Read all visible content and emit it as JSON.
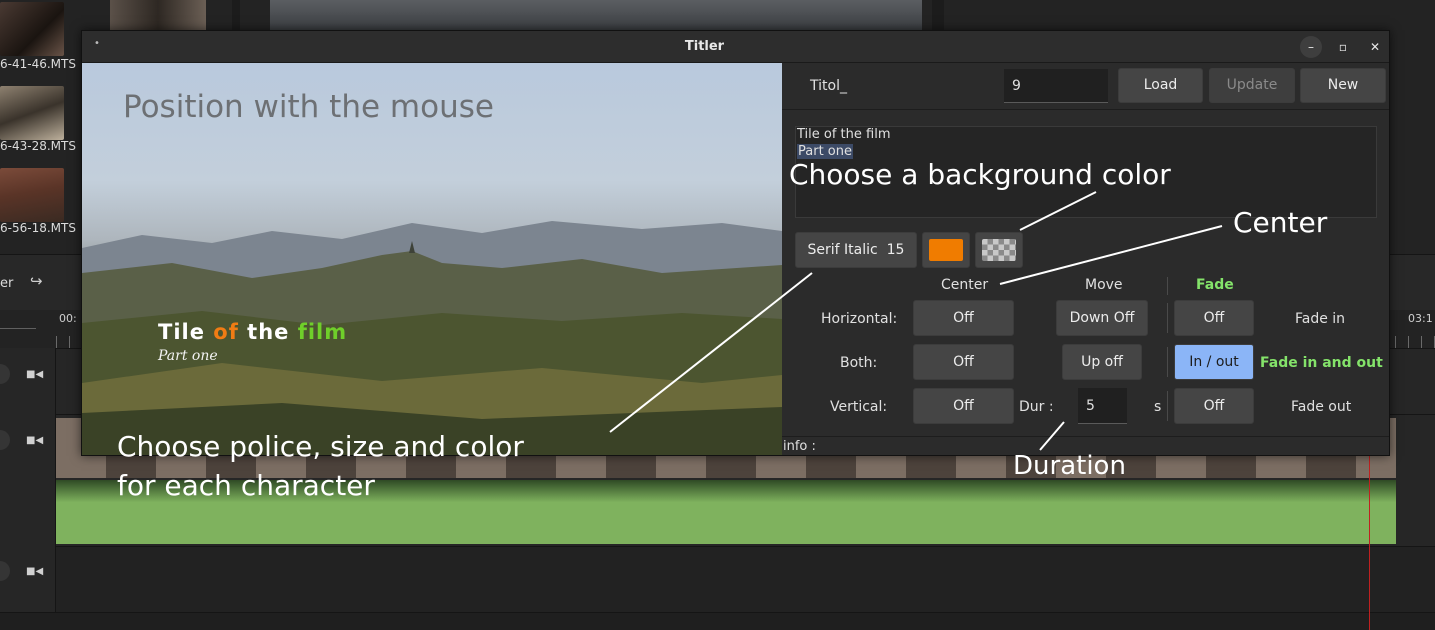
{
  "clips": [
    {
      "label": "6-41-46.MTS"
    },
    {
      "label": "6-43-28.MTS"
    },
    {
      "label": "6-56-18.MTS"
    }
  ],
  "timeline": {
    "toolbar_label": "er",
    "time_left": "00:",
    "time_right": "03:1"
  },
  "window": {
    "title": "Titler",
    "menu_dot": "•",
    "minimize_icon": "–",
    "maximize_icon": "▫",
    "close_icon": "✕"
  },
  "preview": {
    "hint": "Position with the mouse",
    "title_parts": [
      {
        "text": "Tile ",
        "color": "#ffffff"
      },
      {
        "text": "of",
        "color": "#f07c14"
      },
      {
        "text": " the ",
        "color": "#ffffff"
      },
      {
        "text": "film",
        "color": "#6fcf2a"
      }
    ],
    "subtitle": "Part one"
  },
  "panel": {
    "name_label": "Titol_",
    "name_value": "9",
    "load_label": "Load",
    "update_label": "Update",
    "new_label": "New",
    "text_line1": "Tile of the film",
    "text_line2": "Part one",
    "font_label": "Serif Italic",
    "font_size": "15",
    "text_color": "#f07c00",
    "col_center": "Center",
    "col_move": "Move",
    "col_fade": "Fade",
    "row_horizontal": "Horizontal:",
    "row_both": "Both:",
    "row_vertical": "Vertical:",
    "center_h": "Off",
    "center_both": "Off",
    "center_v": "Off",
    "move_down": "Down Off",
    "move_up": "Up off",
    "dur_label": "Dur :",
    "dur_value": "5",
    "dur_unit": "s",
    "fade_in_btn": "Off",
    "fade_both_btn": "In / out",
    "fade_out_btn": "Off",
    "fade_in_label": "Fade in",
    "fade_both_label": "Fade in and out",
    "fade_out_label": "Fade out",
    "info_label": "info :"
  },
  "annotations": {
    "bg_color": "Choose a background color",
    "center": "Center",
    "police_line1": "Choose police, size and color",
    "police_line2": "for each character",
    "duration": "Duration"
  },
  "colors": {
    "accent_blue": "#8bb5f7",
    "fade_green": "#84e36a",
    "audio_green": "#7fb25e",
    "playhead": "#c02020"
  }
}
